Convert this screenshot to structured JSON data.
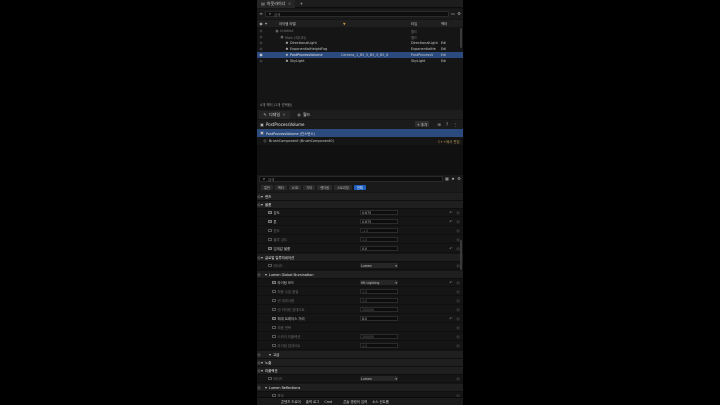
{
  "outliner": {
    "tab_label": "아웃라이너",
    "search_placeholder": "검색",
    "columns": {
      "name": "아이템 라벨",
      "type": "타입",
      "other": "액터"
    },
    "rows": [
      {
        "indent": 0,
        "label": "Untitled",
        "col": "",
        "type": "월드",
        "selected": false
      },
      {
        "indent": 1,
        "label": "Main (에디터)",
        "col": "",
        "type": "월드",
        "selected": false
      },
      {
        "indent": 2,
        "label": "DirectionalLight",
        "col": "",
        "type": "DirectionalLight",
        "other": "Edi",
        "selected": false
      },
      {
        "indent": 2,
        "label": "ExponentialHeightFog",
        "col": "",
        "type": "ExponentialHe",
        "other": "Edi",
        "selected": false
      },
      {
        "indent": 2,
        "label": "PostProcessVolume",
        "col": "Camera_1_B5_5_B5_5_B5_6",
        "type": "PostProcessV",
        "other": "Edi",
        "selected": true
      },
      {
        "indent": 2,
        "label": "SkyLight",
        "col": "",
        "type": "SkyLight",
        "other": "Edi",
        "selected": false
      }
    ],
    "status": "4개 액터 (1개 선택됨)"
  },
  "details": {
    "tab_label": "디테일",
    "tab2_label": "월드",
    "actor_name": "PostProcessVolume",
    "add_label": "+ 추가",
    "component_selected": "PostProcessVolume (인스턴스)",
    "component_row": "BrushComponent (BrushComponent0)",
    "component_row_right": "C++에서 편집",
    "search_placeholder": "검색",
    "filters": [
      "일반",
      "액터",
      "LOD",
      "기타",
      "렌더링",
      "스트리밍",
      "전체"
    ],
    "active_filter": "전체"
  },
  "properties": [
    {
      "kind": "section",
      "label": "렌즈",
      "level": 0
    },
    {
      "kind": "section",
      "label": "블룸",
      "level": 0
    },
    {
      "kind": "prop",
      "checked": true,
      "label": "강도",
      "value": "0.675",
      "control": "slider",
      "level": 1
    },
    {
      "kind": "prop",
      "checked": true,
      "label": "톤",
      "value": "0.675",
      "control": "slider",
      "level": 1
    },
    {
      "kind": "prop",
      "checked": false,
      "label": "한도",
      "value": "-1.0",
      "control": "text",
      "level": 1
    },
    {
      "kind": "prop",
      "checked": false,
      "label": "블루 강도",
      "value": "1.0",
      "control": "text",
      "level": 1
    },
    {
      "kind": "prop",
      "checked": true,
      "label": "임계값 블룸",
      "value": "0.0",
      "control": "text",
      "level": 1
    },
    {
      "kind": "section",
      "label": "글로벌 일루미네이션",
      "level": 0
    },
    {
      "kind": "prop",
      "checked": false,
      "label": "메서드",
      "value": "Lumen",
      "control": "dropdown",
      "level": 1
    },
    {
      "kind": "section",
      "label": "Lumen Global Illumination",
      "level": 1
    },
    {
      "kind": "prop",
      "checked": true,
      "label": "라이팅 모드",
      "value": "Hit Lighting",
      "control": "dropdown",
      "level": 2
    },
    {
      "kind": "prop",
      "checked": false,
      "label": "최종 수집 품질",
      "value": "1.0",
      "control": "text",
      "level": 2
    },
    {
      "kind": "prop",
      "checked": false,
      "label": "씬 세부사항",
      "value": "1.0",
      "control": "text",
      "level": 2
    },
    {
      "kind": "prop",
      "checked": false,
      "label": "씬 라이팅 업데이트",
      "value": "200000",
      "control": "text",
      "level": 2
    },
    {
      "kind": "prop",
      "checked": true,
      "label": "최대 트레이스 거리",
      "value": "8.0",
      "control": "text",
      "level": 2
    },
    {
      "kind": "prop",
      "checked": false,
      "label": "최종 반복",
      "value": "",
      "control": "none",
      "level": 2
    },
    {
      "kind": "prop",
      "checked": false,
      "label": "스카이 리플렉션",
      "value": "200000",
      "control": "text",
      "level": 2
    },
    {
      "kind": "prop",
      "checked": false,
      "label": "라이팅 업데이트",
      "value": "1.0",
      "control": "text",
      "level": 2
    },
    {
      "kind": "section",
      "label": "고급",
      "level": 2
    },
    {
      "kind": "section",
      "label": "노출",
      "level": 0
    },
    {
      "kind": "section",
      "label": "리플렉션",
      "level": 0
    },
    {
      "kind": "prop",
      "checked": false,
      "label": "메서드",
      "value": "Lumen",
      "control": "dropdown",
      "level": 1
    },
    {
      "kind": "section",
      "label": "Lumen Reflections",
      "level": 1
    },
    {
      "kind": "prop",
      "checked": false,
      "label": "품질",
      "value": "",
      "control": "none",
      "level": 2
    }
  ],
  "bottombar": {
    "items": [
      "콘텐츠 드로어",
      "출력 로그",
      "Cmd",
      "콘솔 명령어 입력",
      "소스 컨트롤"
    ]
  },
  "colors": {
    "panel": "#151515",
    "selection": "#2b4a7e",
    "accent": "#1f5fbf"
  }
}
